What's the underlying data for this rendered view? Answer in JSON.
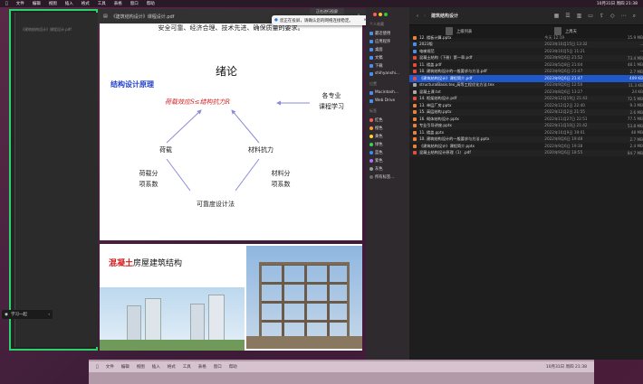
{
  "menubar": {
    "items": [
      "文件",
      "编辑",
      "视图",
      "插入",
      "格式",
      "工具",
      "表格",
      "窗口",
      "帮助"
    ],
    "right": [
      "10月31日 周四 21:38"
    ]
  },
  "doc": {
    "filename": "《建筑结构设计》课程设计.pdf",
    "top_text": "安全可靠、经济合理、技术先进、确保质量的要求。",
    "slide1": {
      "title": "绪论",
      "subtitle": "结构设计原理",
      "formula": "荷载效应S≤结构抗力R",
      "side": "各专业\n课程学习",
      "left_node": "荷载",
      "right_node": "材料抗力",
      "left_factor": "荷载分\n项系数",
      "right_factor": "材料分\n项系数",
      "bottom": "可靠度设计法"
    },
    "slide2": {
      "title_red": "混凝土",
      "title_black": "房屋建筑结构"
    }
  },
  "toast": {
    "label": "正在进行投屏",
    "text": "您正在投屏，请确认您的网络连接稳定。"
  },
  "finder": {
    "title": "建筑结构设计",
    "sidebar_sections": [
      {
        "head": "个人收藏",
        "items": [
          "最近使用",
          "应用程序",
          "桌面",
          "文稿",
          "下载",
          "shihyanshi..."
        ]
      },
      {
        "head": "位置",
        "items": [
          "Macintosh...",
          "Web Drive"
        ]
      },
      {
        "head": "标签",
        "items": [
          "红色",
          "橙色",
          "黄色",
          "绿色",
          "蓝色",
          "紫色",
          "灰色",
          "所有标签..."
        ]
      }
    ],
    "tag_colors": [
      "#ff5b5b",
      "#ff9a2e",
      "#ffd42e",
      "#3fcf5b",
      "#3a8cff",
      "#b06bff",
      "#9a9a9a",
      "#666666"
    ],
    "header_left": "上级列表",
    "header_right": "上周天",
    "files": [
      {
        "name": "12. 楼板计算.pptx",
        "date": "今天 12:19",
        "size": "15.9 MB",
        "type": "ppt"
      },
      {
        "name": "2023版",
        "date": "2023年10月15日 13:32",
        "size": "--",
        "type": "folder"
      },
      {
        "name": "电梯规范",
        "date": "2023年10月5日 11:21",
        "size": "--",
        "type": "folder"
      },
      {
        "name": "混凝土结构（下册）第一章.pdf",
        "date": "2023年9月6日 21:52",
        "size": "73.4 MB",
        "type": "pdf"
      },
      {
        "name": "11. 楼盖.pdf",
        "date": "2023年5月8日 21:04",
        "size": "48.1 MB",
        "type": "pdf"
      },
      {
        "name": "10. 建筑结构设计的一般要求与方法.pdf",
        "date": "2023年9月6日 21:47",
        "size": "2.7 MB",
        "type": "pdf"
      },
      {
        "name": "《建筑结构设计》课程简介.pdf",
        "date": "2023年9月6日 21:47",
        "size": "409 KB",
        "type": "pdf",
        "selected": true
      },
      {
        "name": "structuralBasis.tex_高等工程优化方法.tex",
        "date": "2023年9月6日 12:50",
        "size": "11.3 KB",
        "type": "doc"
      },
      {
        "name": "混凝土课.txt",
        "date": "2023年8月6日 13:27",
        "size": "24 KB",
        "type": "doc"
      },
      {
        "name": "14. 框架结构设计.pdf",
        "date": "2022年12月19日 21:43",
        "size": "72.5 MB",
        "type": "pdf"
      },
      {
        "name": "13. 单层厂房.pptx",
        "date": "2022年12月2日 22:40",
        "size": "9.3 MB",
        "type": "ppt"
      },
      {
        "name": "15. 高层结构.pptx",
        "date": "2022年12月2日 21:55",
        "size": "2.6 MB",
        "type": "ppt"
      },
      {
        "name": "16. 砌体结构设计.pptx",
        "date": "2022年11月27日 22:51",
        "size": "77.5 MB",
        "type": "ppt"
      },
      {
        "name": "专业引导讲座.pptx",
        "date": "2022年11月10日 21:42",
        "size": "53.8 MB",
        "type": "ppt"
      },
      {
        "name": "11. 楼盖.pptx",
        "date": "2022年10月9日 19:01",
        "size": "48 MB",
        "type": "ppt"
      },
      {
        "name": "10. 建筑结构设计的一般要求与方法.pptx",
        "date": "2022年9月6日 19:48",
        "size": "2.7 MB",
        "type": "ppt"
      },
      {
        "name": "《建筑结构设计》课程简介.pptx",
        "date": "2022年9月6日 19:38",
        "size": "2.4 MB",
        "type": "ppt"
      },
      {
        "name": "混凝土结构设计原理（1）.pdf",
        "date": "2020年9月6日 18:55",
        "size": "84.7 MB",
        "type": "pdf"
      }
    ]
  },
  "pill": {
    "label": "学习一起"
  },
  "dock": {
    "items": [
      "文件",
      "编辑",
      "视图",
      "插入",
      "格式",
      "工具",
      "表格",
      "窗口",
      "帮助"
    ],
    "right": [
      "10月31日 周四 21:38"
    ]
  }
}
